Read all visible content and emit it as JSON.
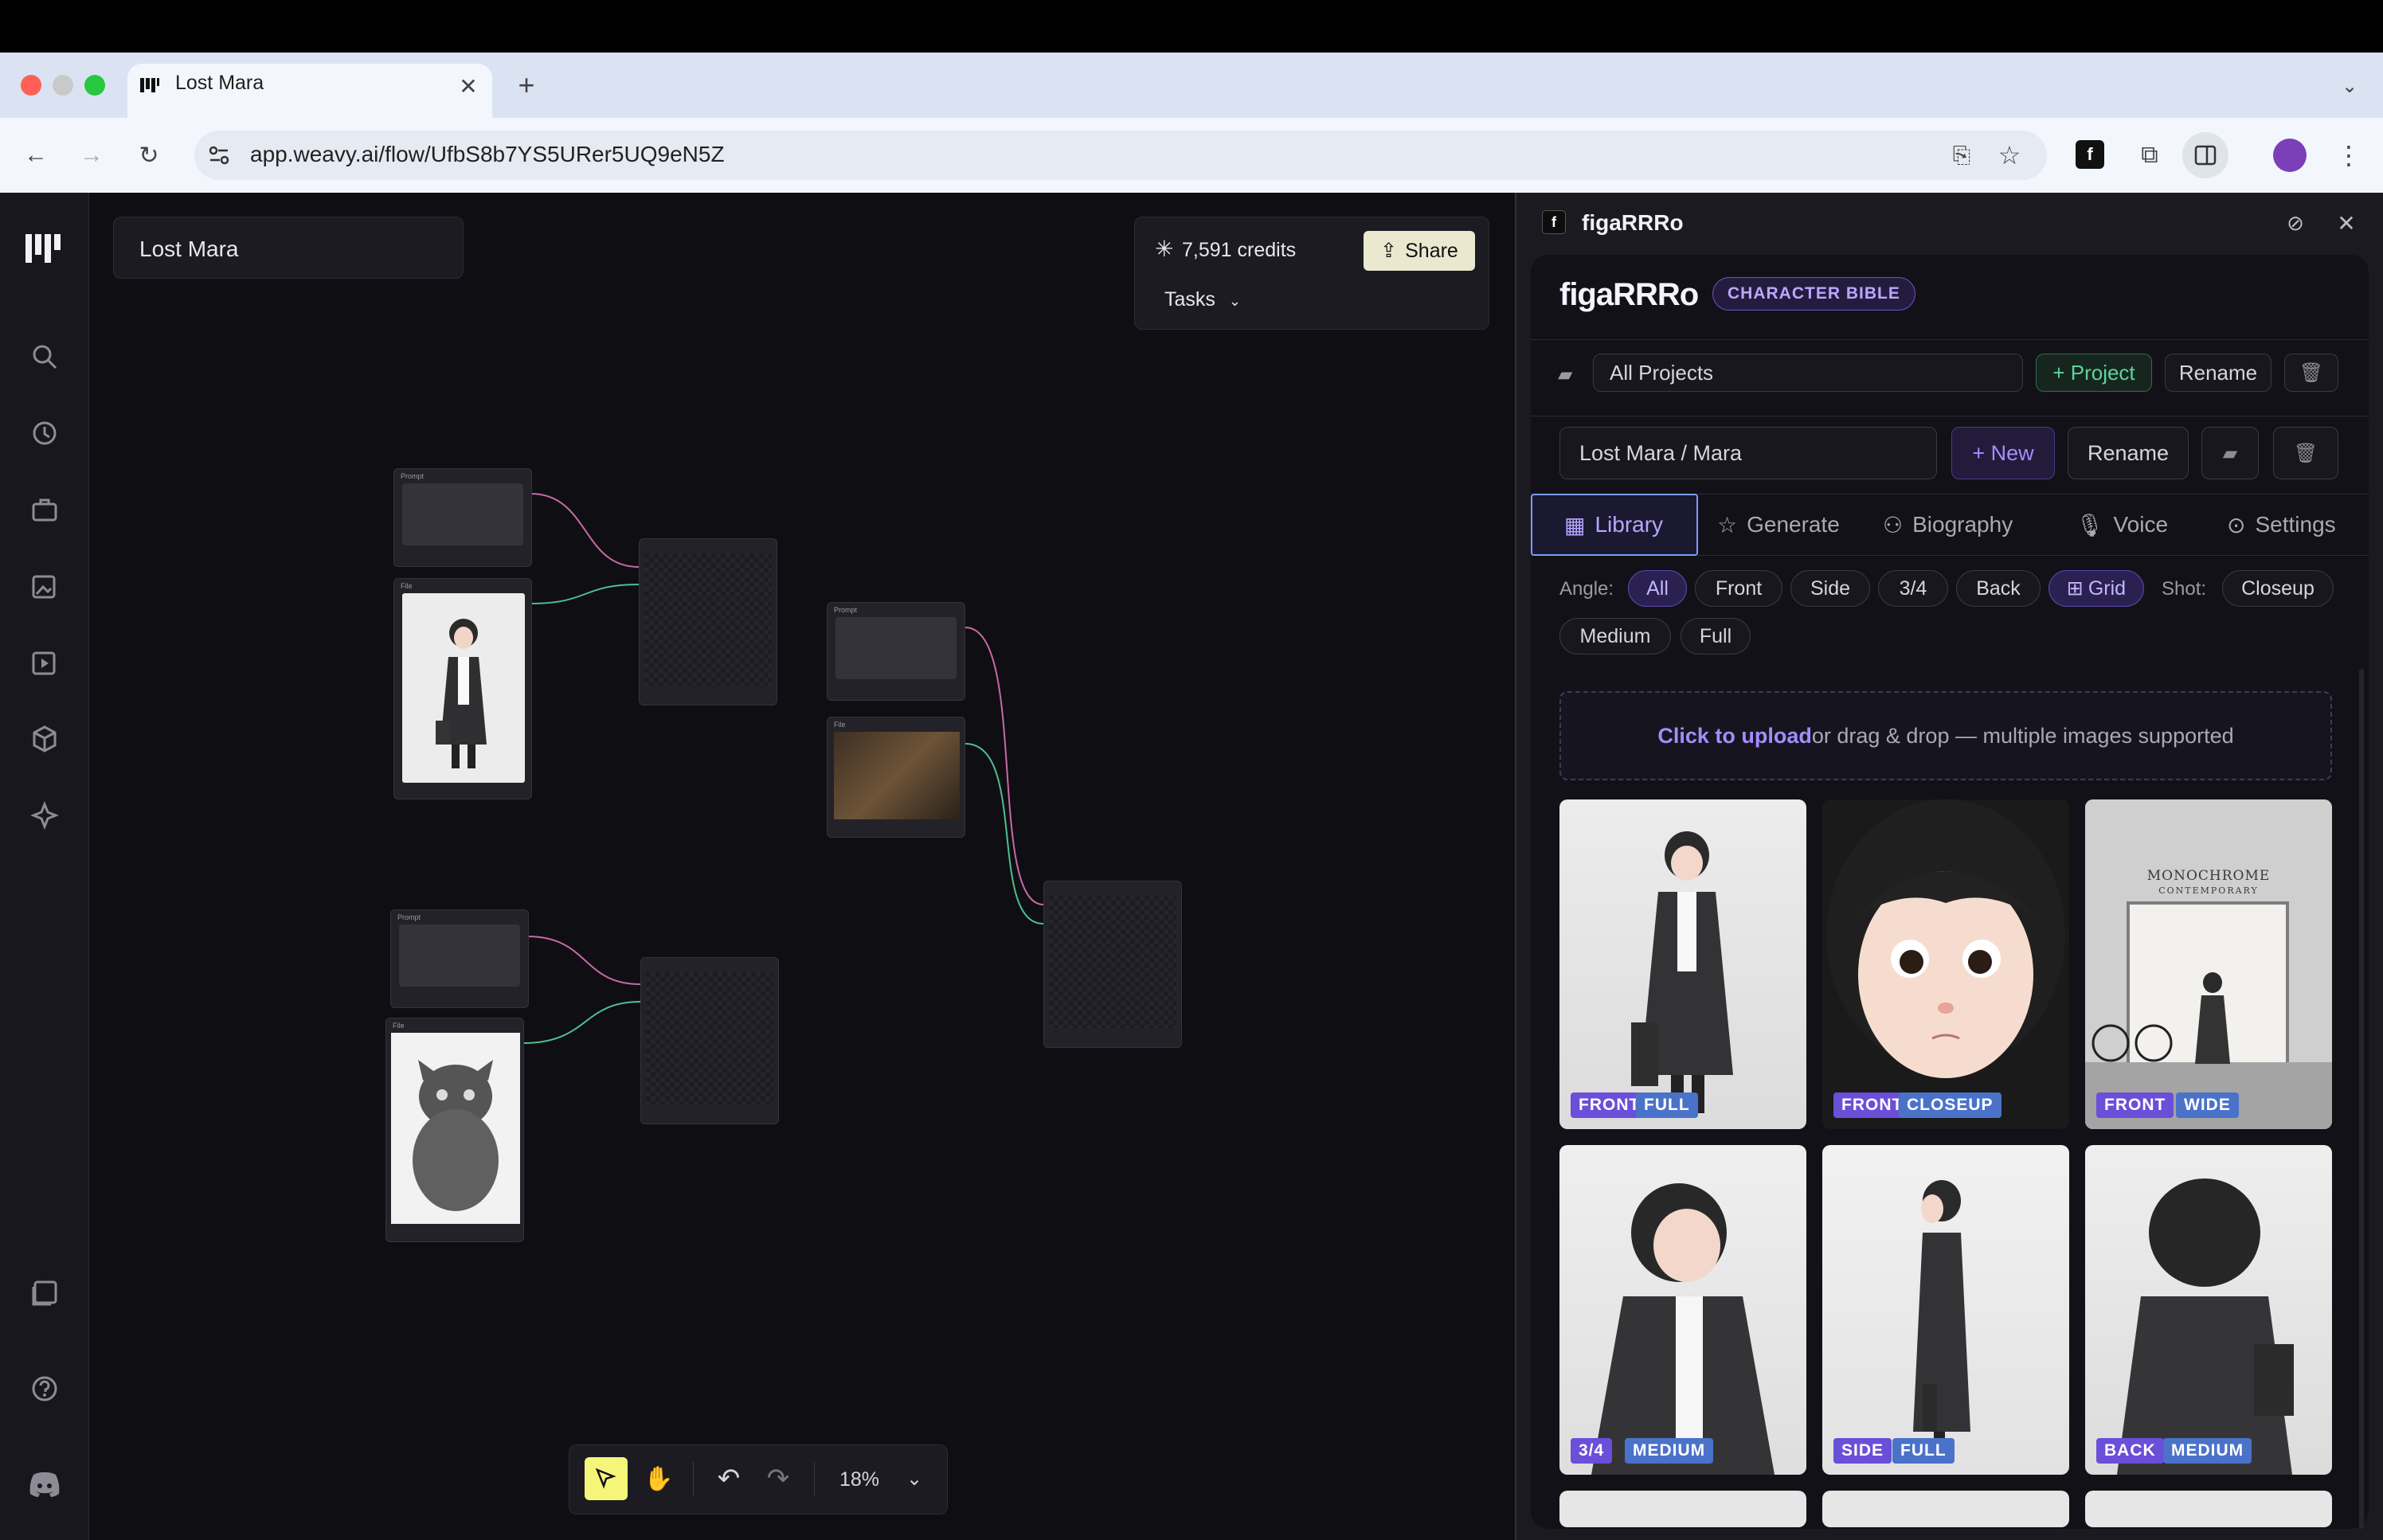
{
  "browser": {
    "tab_title": "Lost Mara",
    "url": "app.weavy.ai/flow/UfbS8b7YS5URer5UQ9eN5Z"
  },
  "app": {
    "project_name": "Lost Mara",
    "credits": "7,591 credits",
    "share_label": "Share",
    "tasks_label": "Tasks",
    "zoom": "18%"
  },
  "nodes": {
    "prompt_label": "Prompt",
    "file_label": "File"
  },
  "panel": {
    "title": "figaRRRo",
    "brand": "figaRRRo",
    "badge": "CHARACTER BIBLE",
    "project_select": "All Projects",
    "add_project": "+ Project",
    "rename": "Rename",
    "character_select": "Lost Mara / Mara",
    "add_new": "+ New",
    "tabs": [
      "Library",
      "Generate",
      "Biography",
      "Voice",
      "Settings"
    ],
    "angle_label": "Angle:",
    "angles": [
      "All",
      "Front",
      "Side",
      "3/4",
      "Back"
    ],
    "grid_label": "Grid",
    "shot_label": "Shot:",
    "shots": [
      "Closeup",
      "Medium",
      "Full"
    ],
    "upload_link": "Click to upload",
    "upload_rest": " or drag & drop — multiple images supported",
    "thumbs": [
      {
        "tags": [
          "FRONT",
          "FULL"
        ]
      },
      {
        "tags": [
          "FRONT",
          "CLOSEUP"
        ]
      },
      {
        "tags": [
          "FRONT",
          "WIDE"
        ],
        "sign": "MONOCHROME",
        "sign2": "CONTEMPORARY"
      },
      {
        "tags": [
          "3/4",
          "MEDIUM"
        ]
      },
      {
        "tags": [
          "SIDE",
          "FULL"
        ]
      },
      {
        "tags": [
          "BACK",
          "MEDIUM"
        ]
      }
    ]
  },
  "colors": {
    "accent": "#7c5cff",
    "tag_primary": "#6a4fd8",
    "tag_secondary": "#4a72c9",
    "green": "#5fd39a",
    "selected": "#f5f57a"
  }
}
